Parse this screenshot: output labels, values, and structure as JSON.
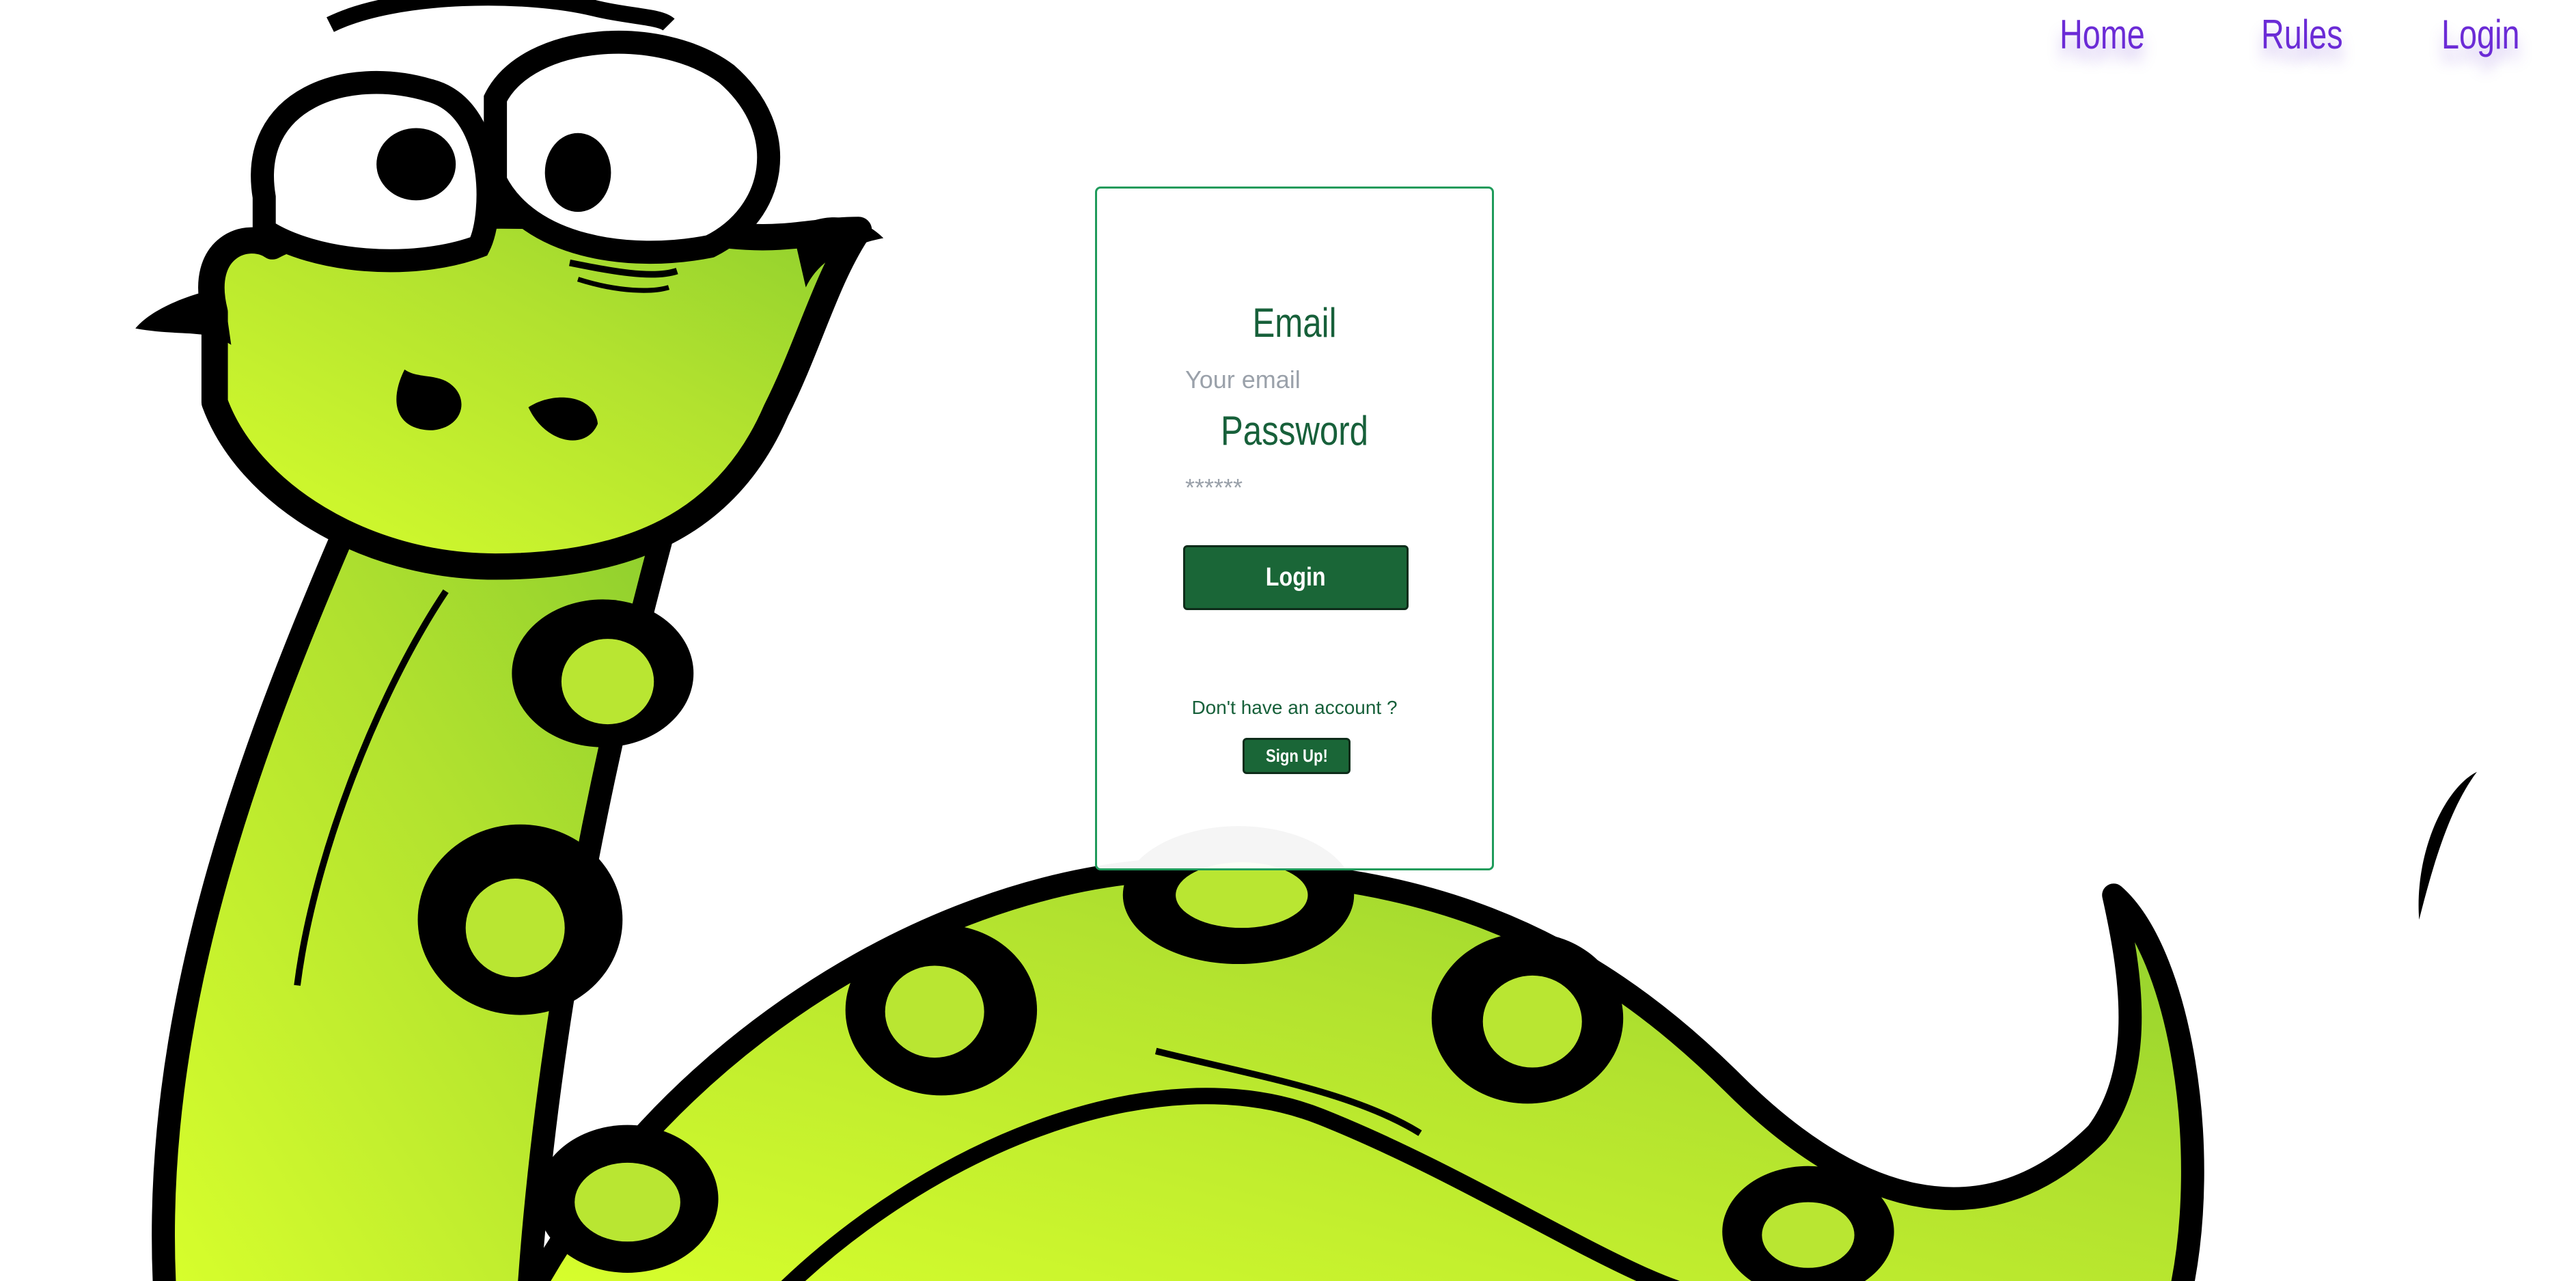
{
  "nav": {
    "home_label": "Home",
    "rules_label": "Rules",
    "login_label": "Login"
  },
  "form": {
    "email_label": "Email",
    "email_placeholder": "Your email",
    "password_label": "Password",
    "password_placeholder": "******",
    "login_button_label": "Login",
    "no_account_text": "Don't have an account ?",
    "signup_button_label": "Sign Up!"
  },
  "colors": {
    "nav_link": "#6b2bd6",
    "card_border": "#1f9b5b",
    "heading_green": "#17603a",
    "button_green": "#1a6637",
    "snake_green": "#b5e42f"
  },
  "background_image": "cartoon-snake-illustration"
}
